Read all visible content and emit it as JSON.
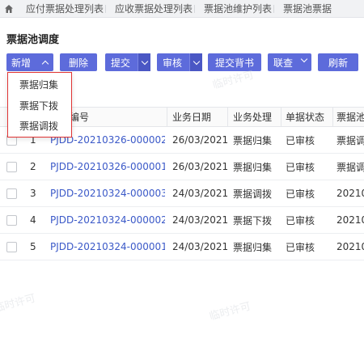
{
  "tabs": [
    {
      "label": "应付票据处理列表"
    },
    {
      "label": "应收票据处理列表"
    },
    {
      "label": "票据池维护列表"
    },
    {
      "label": "票据池票据"
    }
  ],
  "page": {
    "title": "票据池调度"
  },
  "toolbar": {
    "add": "新增",
    "delete": "删除",
    "submit": "提交",
    "audit": "审核",
    "submit_endorse": "提交背书",
    "joint_check": "联查",
    "refresh": "刷新"
  },
  "add_menu": [
    "票据归集",
    "票据下拨",
    "票据调拨"
  ],
  "table": {
    "headers": [
      "",
      "",
      "编号",
      "业务日期",
      "业务处理",
      "单据状态",
      "票据池"
    ],
    "rows": [
      {
        "idx": "1",
        "code": "PJDD-20210326-000002",
        "date": "26/03/2021",
        "biz": "票据归集",
        "status": "已审核",
        "pool": "票据调"
      },
      {
        "idx": "2",
        "code": "PJDD-20210326-000001",
        "date": "26/03/2021",
        "biz": "票据归集",
        "status": "已审核",
        "pool": "票据调"
      },
      {
        "idx": "3",
        "code": "PJDD-20210324-000003",
        "date": "24/03/2021",
        "biz": "票据调拨",
        "status": "已审核",
        "pool": "20210"
      },
      {
        "idx": "4",
        "code": "PJDD-20210324-000002",
        "date": "24/03/2021",
        "biz": "票据下拨",
        "status": "已审核",
        "pool": "20210"
      },
      {
        "idx": "5",
        "code": "PJDD-20210324-000001",
        "date": "24/03/2021",
        "biz": "票据归集",
        "status": "已审核",
        "pool": "20210"
      }
    ]
  },
  "watermark": [
    "临时许可",
    "临时许可",
    "临时许可"
  ],
  "colors": {
    "primary_button": "#5d6bdb",
    "link": "#3b59c8",
    "menu_border": "#e03434"
  }
}
